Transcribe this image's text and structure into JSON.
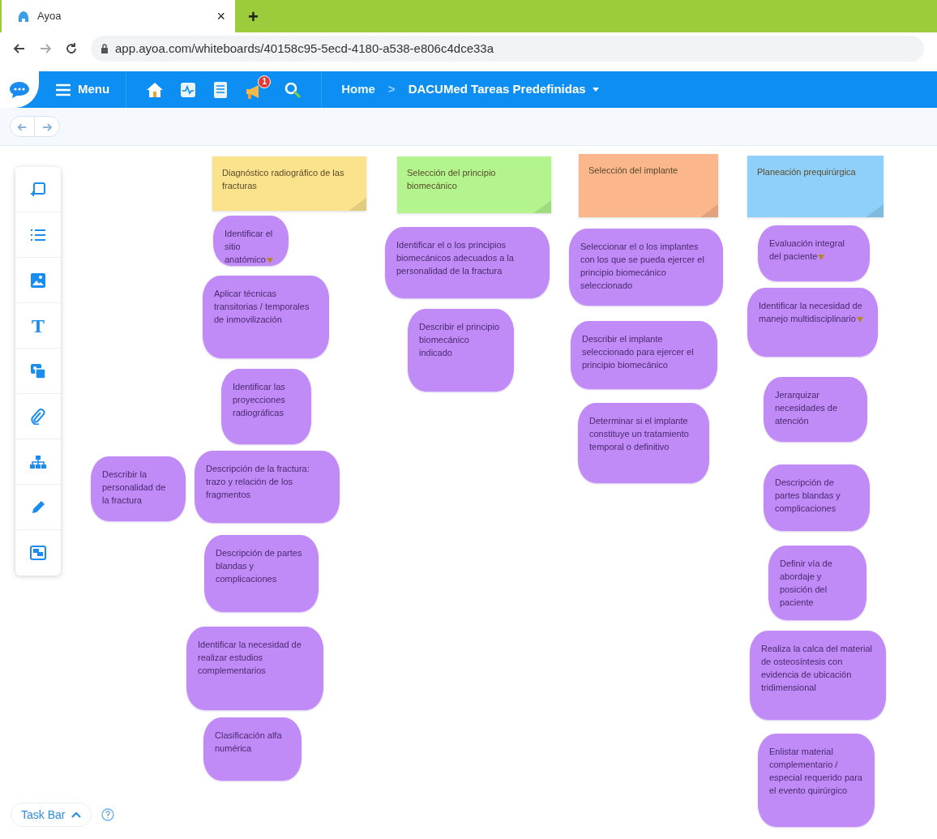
{
  "browser": {
    "tab_title": "Ayoa",
    "tab_close": "×",
    "new_tab": "+",
    "url": "app.ayoa.com/whiteboards/40158c95-5ecd-4180-a538-e806c4dce33a"
  },
  "app_bar": {
    "menu": "Menu",
    "notification_count": "1",
    "breadcrumb": {
      "home": "Home",
      "separator": ">",
      "current": "DACUMed Tareas Predefinidas"
    }
  },
  "left_toolbar": {
    "text_tool": "T"
  },
  "board": {
    "columns": [
      {
        "header": {
          "text": "Diagnóstico radiográfico de las fracturas",
          "color": "#fbe38e"
        },
        "cards": [
          {
            "text": "Identificar el sitio anatómico",
            "marked": true
          },
          {
            "text": "Aplicar técnicas transitorias / temporales de inmovilización",
            "marked": false
          },
          {
            "text": "Identificar las proyecciones radiográficas",
            "marked": false
          },
          {
            "text": "Describir la personalidad de la fractura",
            "marked": false
          },
          {
            "text": "Descripción de la fractura: trazo y relación de los fragmentos",
            "marked": false
          },
          {
            "text": "Descripción de partes blandas y complicaciones",
            "marked": false
          },
          {
            "text": "Identificar la necesidad de realizar estudios complementarios",
            "marked": false
          },
          {
            "text": "Clasificación alfa numérica",
            "marked": false
          }
        ]
      },
      {
        "header": {
          "text": "Selección del principio biomecánico",
          "color": "#b3f48f"
        },
        "cards": [
          {
            "text": "Identificar el o los principios biomecánicos adecuados a la personalidad de la fractura",
            "marked": false
          },
          {
            "text": "Describir el principio biomecánico indicado",
            "marked": false
          }
        ]
      },
      {
        "header": {
          "text": "Selección del implante",
          "color": "#fbb68c"
        },
        "cards": [
          {
            "text": "Seleccionar el o los implantes con los que se pueda ejercer el principio biomecánico seleccionado",
            "marked": false
          },
          {
            "text": "Describir el implante seleccionado para ejercer el principio biomecánico",
            "marked": false
          },
          {
            "text": "Determinar si el implante constituye un tratamiento temporal o definitivo",
            "marked": false
          }
        ]
      },
      {
        "header": {
          "text": "Planeación prequirúrgica",
          "color": "#8fd0fa"
        },
        "cards": [
          {
            "text": "Evaluación integral del paciente",
            "marked": true
          },
          {
            "text": "Identificar la necesidad de manejo multidisciplinario",
            "marked": true
          },
          {
            "text": "Jerarquizar necesidades de atención",
            "marked": false
          },
          {
            "text": "Descripción de partes blandas y complicaciones",
            "marked": false
          },
          {
            "text": "Definir vía de abordaje y posición del paciente",
            "marked": false
          },
          {
            "text": "Realiza la calca del material de osteosíntesis con evidencia de ubicación tridimensional",
            "marked": false
          },
          {
            "text": "Enlistar material complementario / especial requerido para el evento quirúrgico",
            "marked": false
          }
        ]
      }
    ]
  },
  "task_bar": {
    "label": "Task Bar"
  }
}
